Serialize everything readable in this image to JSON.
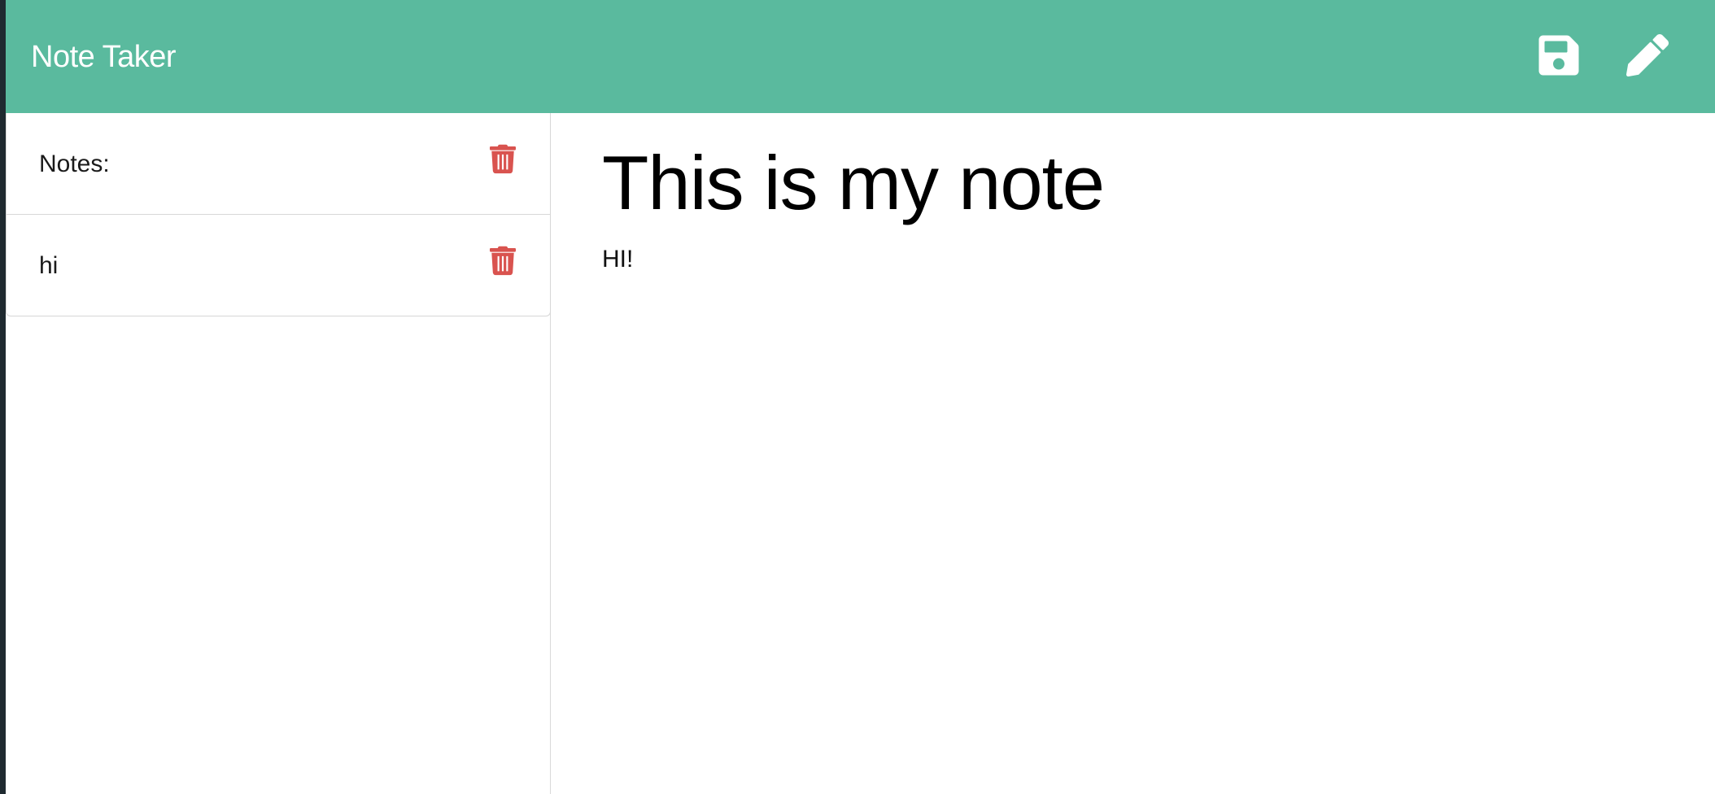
{
  "app": {
    "title": "Note Taker",
    "brand_color": "#5aba9e",
    "delete_color": "#d9534f"
  },
  "navbar": {
    "icons": [
      {
        "name": "save-icon"
      },
      {
        "name": "pencil-icon"
      }
    ]
  },
  "sidebar": {
    "items": [
      {
        "label": "Notes:"
      },
      {
        "label": "hi"
      }
    ]
  },
  "editor": {
    "title": "This is my note",
    "body": "HI!"
  }
}
